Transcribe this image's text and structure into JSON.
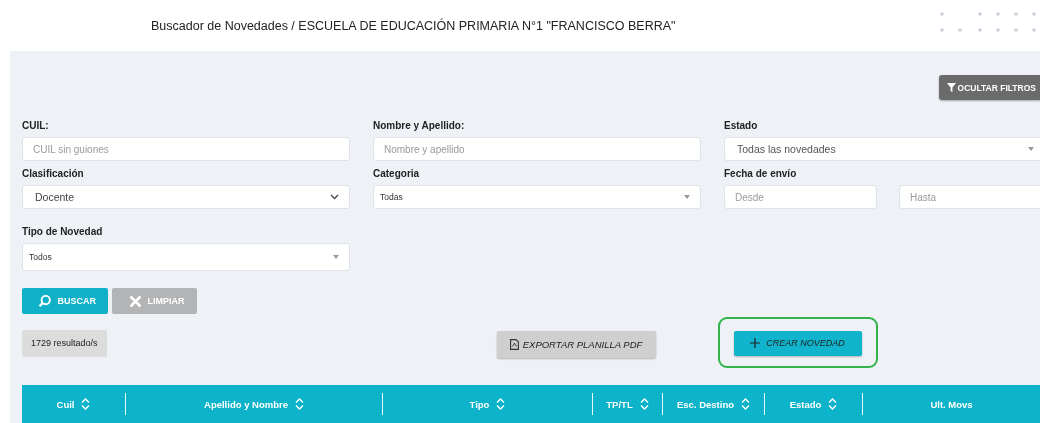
{
  "header": {
    "title": "Buscador de Novedades / ESCUELA DE EDUCACIÓN PRIMARIA N°1 \"FRANCISCO BERRA\""
  },
  "hide_filters_button": "OCULTAR FILTROS",
  "filters": [
    {
      "label": "CUIL:",
      "kind": "text",
      "placeholder": "CUIL sin guiones"
    },
    {
      "label": "Nombre y Apellido:",
      "kind": "text",
      "placeholder": "Nombre y apellido"
    },
    {
      "label": "Estado",
      "kind": "select",
      "value": "Todas las novedades"
    },
    {
      "label": "Clasificación",
      "kind": "native-select",
      "value": "Docente"
    },
    {
      "label": "Categoria",
      "kind": "select",
      "value": "Todas"
    },
    {
      "label": "Fecha de envío",
      "kind": "range",
      "placeholders": [
        "Desde",
        "Hasta"
      ]
    },
    {
      "label": "Tipo de Novedad",
      "kind": "select",
      "value": "Todos"
    }
  ],
  "search_button": "BUSCAR",
  "clear_button": "LIMPIAR",
  "results_count": "1729 resultado/s",
  "export_button": "EXPORTAR PLANILLA PDF",
  "create_button": {
    "label": "CREAR NOVEDAD",
    "highlighted": true
  },
  "table": {
    "columns": [
      {
        "label": "Cuil",
        "sortable": true
      },
      {
        "label": "Apellido y Nombre",
        "sortable": true
      },
      {
        "label": "Tipo",
        "sortable": true
      },
      {
        "label": "TP/TL",
        "sortable": true
      },
      {
        "label": "Esc. Destino",
        "sortable": true
      },
      {
        "label": "Estado",
        "sortable": true
      },
      {
        "label": "Ult. Movs",
        "sortable": false
      }
    ]
  }
}
